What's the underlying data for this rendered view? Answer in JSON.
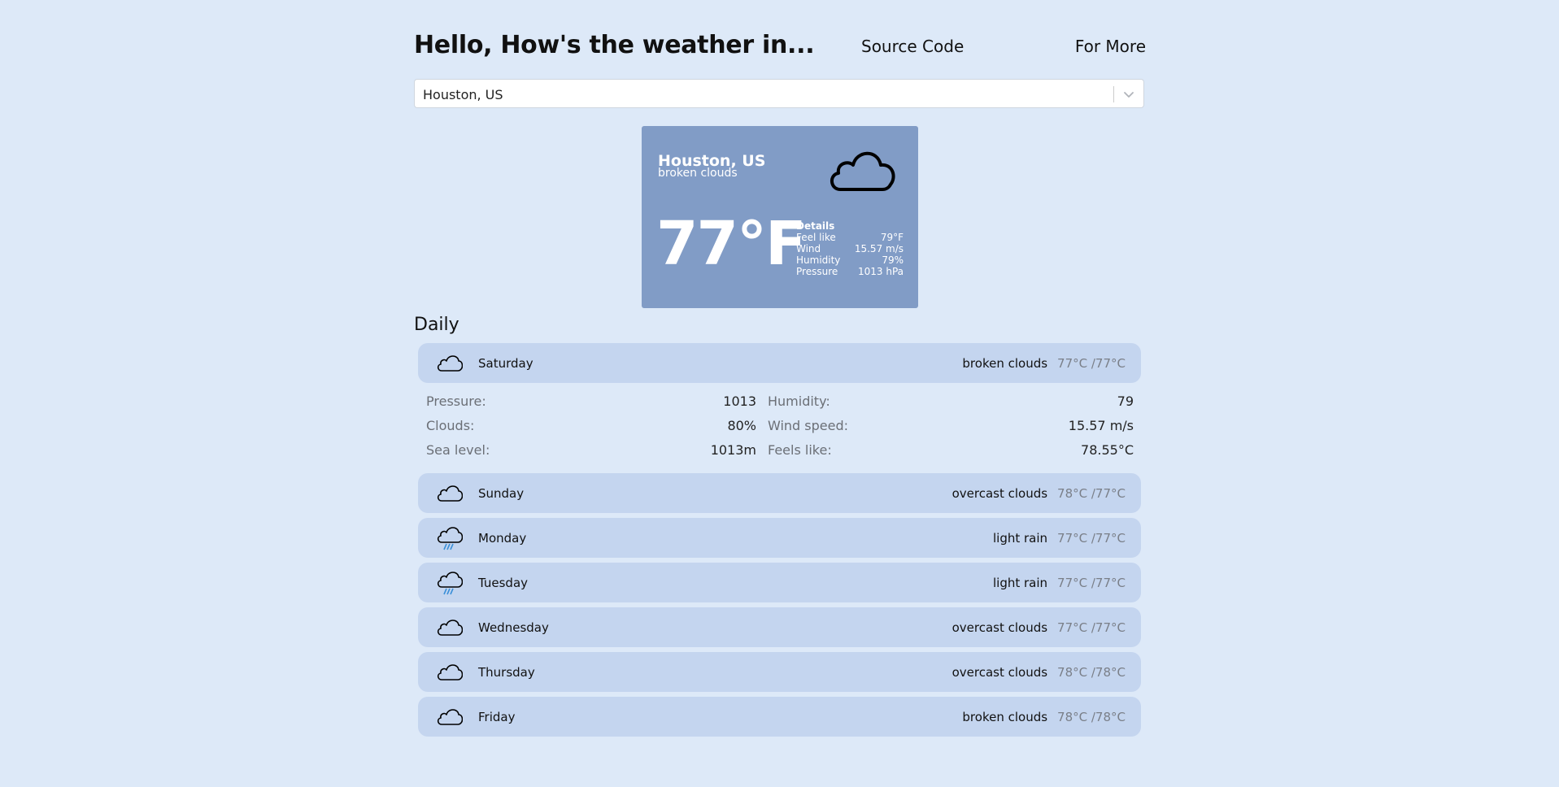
{
  "header": {
    "title": "Hello, How's the weather in...",
    "source_code": "Source Code",
    "for_more": "For More"
  },
  "search": {
    "value": "Houston, US"
  },
  "current": {
    "city": "Houston, US",
    "description": "broken clouds",
    "temperature": "77°F",
    "details_title": "Details",
    "details": [
      {
        "label": "Feel like",
        "value": "79°F"
      },
      {
        "label": "Wind",
        "value": "15.57 m/s"
      },
      {
        "label": "Humidity",
        "value": "79%"
      },
      {
        "label": "Pressure",
        "value": "1013 hPa"
      }
    ],
    "icon": "cloud-icon"
  },
  "daily": {
    "title": "Daily",
    "days": [
      {
        "name": "Saturday",
        "description": "broken clouds",
        "temps": "77°C /77°C",
        "icon": "cloud-icon"
      },
      {
        "name": "Sunday",
        "description": "overcast clouds",
        "temps": "78°C /77°C",
        "icon": "cloud-icon"
      },
      {
        "name": "Monday",
        "description": "light rain",
        "temps": "77°C /77°C",
        "icon": "rain-cloud-icon"
      },
      {
        "name": "Tuesday",
        "description": "light rain",
        "temps": "77°C /77°C",
        "icon": "rain-cloud-icon"
      },
      {
        "name": "Wednesday",
        "description": "overcast clouds",
        "temps": "77°C /77°C",
        "icon": "cloud-icon"
      },
      {
        "name": "Thursday",
        "description": "overcast clouds",
        "temps": "78°C /78°C",
        "icon": "cloud-icon"
      },
      {
        "name": "Friday",
        "description": "broken clouds",
        "temps": "78°C /78°C",
        "icon": "cloud-icon"
      }
    ],
    "expanded": {
      "pressure_label": "Pressure:",
      "pressure": "1013",
      "humidity_label": "Humidity:",
      "humidity": "79",
      "clouds_label": "Clouds:",
      "clouds": "80%",
      "wind_label": "Wind speed:",
      "wind": "15.57 m/s",
      "sea_label": "Sea level:",
      "sea": "1013m",
      "feels_label": "Feels like:",
      "feels": "78.55°C"
    }
  },
  "colors": {
    "background": "#dde9f8",
    "card": "#819cc6",
    "day_row": "#c4d5ef",
    "rain": "#3a8fd8"
  }
}
